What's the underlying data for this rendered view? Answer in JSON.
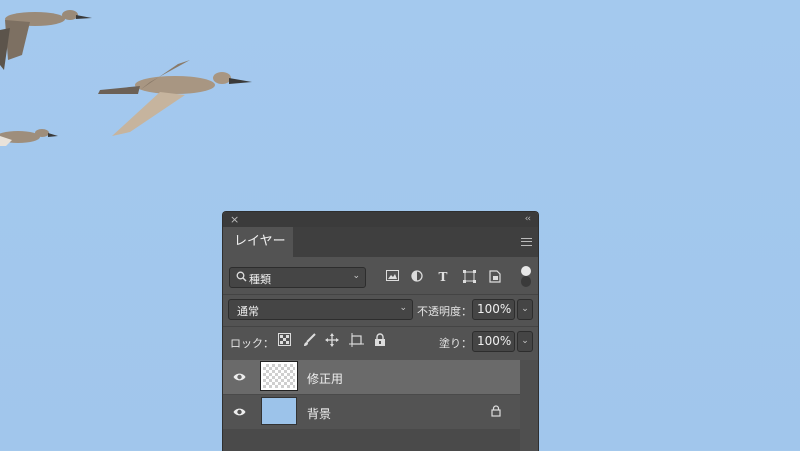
{
  "panel": {
    "title_close": "×",
    "collapse": "‹‹",
    "tab_label": "レイヤー",
    "menu_icon": "panel-menu-icon"
  },
  "filter": {
    "search_icon": "Q",
    "kind_value": "種類",
    "icons": [
      "image-filter-icon",
      "adjustment-filter-icon",
      "type-filter-icon",
      "shape-filter-icon",
      "smart-object-filter-icon"
    ]
  },
  "blend": {
    "mode_value": "通常",
    "opacity_label": "不透明度：",
    "opacity_value": "100%"
  },
  "lock": {
    "label": "ロック：",
    "icons": [
      "lock-transparent-pixels-icon",
      "lock-image-pixels-icon",
      "lock-position-icon",
      "lock-artboard-icon",
      "lock-all-icon"
    ],
    "fill_label": "塗り：",
    "fill_value": "100%"
  },
  "layers": [
    {
      "name": "修正用",
      "visible": true,
      "selected": true,
      "thumb": "transparent",
      "locked": false
    },
    {
      "name": "背景",
      "visible": true,
      "selected": false,
      "thumb": "sky",
      "locked": true
    }
  ]
}
